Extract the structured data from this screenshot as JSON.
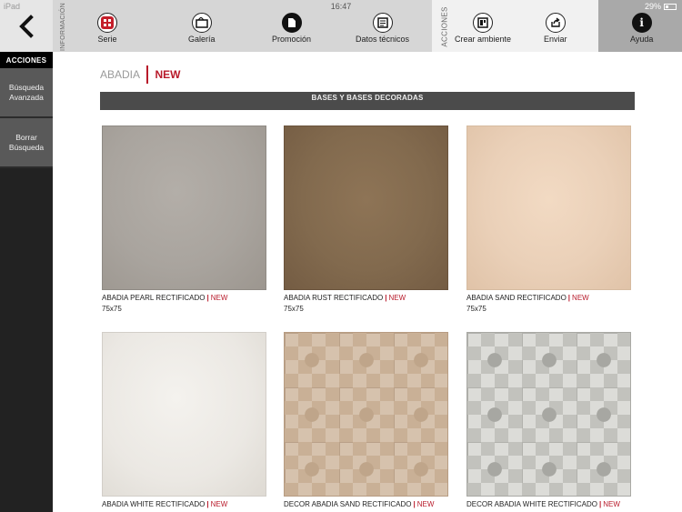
{
  "status_bar": {
    "carrier": "iPad",
    "time": "16:47",
    "battery": "29%"
  },
  "toolbar": {
    "info_section_label": "INFORMACIÓN",
    "actions_section_label": "ACCIONES",
    "items": [
      {
        "label": "Serie",
        "icon": "grid-icon"
      },
      {
        "label": "Galería",
        "icon": "gallery-icon"
      },
      {
        "label": "Promoción",
        "icon": "promotion-icon"
      },
      {
        "label": "Datos técnicos",
        "icon": "technical-data-icon"
      },
      {
        "label": "Crear ambiente",
        "icon": "create-room-icon"
      },
      {
        "label": "Enviar",
        "icon": "share-icon"
      },
      {
        "label": "Ayuda",
        "icon": "info-icon"
      }
    ]
  },
  "sidebar": {
    "header": "ACCIONES",
    "buttons": [
      {
        "label": "Búsqueda Avanzada"
      },
      {
        "label": "Borrar Búsqueda"
      }
    ]
  },
  "breadcrumb": {
    "parent": "ABADIA",
    "current": "NEW"
  },
  "section_title": "BASES Y BASES DECORADAS",
  "products": [
    {
      "name": "ABADIA PEARL RECTIFICADO",
      "badge": "NEW",
      "size": "75x75"
    },
    {
      "name": "ABADIA RUST RECTIFICADO",
      "badge": "NEW",
      "size": "75x75"
    },
    {
      "name": "ABADIA SAND RECTIFICADO",
      "badge": "NEW",
      "size": "75x75"
    },
    {
      "name": "ABADIA WHITE RECTIFICADO",
      "badge": "NEW",
      "size": ""
    },
    {
      "name": "DECOR ABADIA SAND RECTIFICADO",
      "badge": "NEW",
      "size": ""
    },
    {
      "name": "DECOR ABADIA WHITE RECTIFICADO",
      "badge": "NEW",
      "size": ""
    }
  ],
  "colors": {
    "accent": "#b81a2a",
    "sidebar_bg": "#222222",
    "section_bar": "#4b4b4b"
  }
}
